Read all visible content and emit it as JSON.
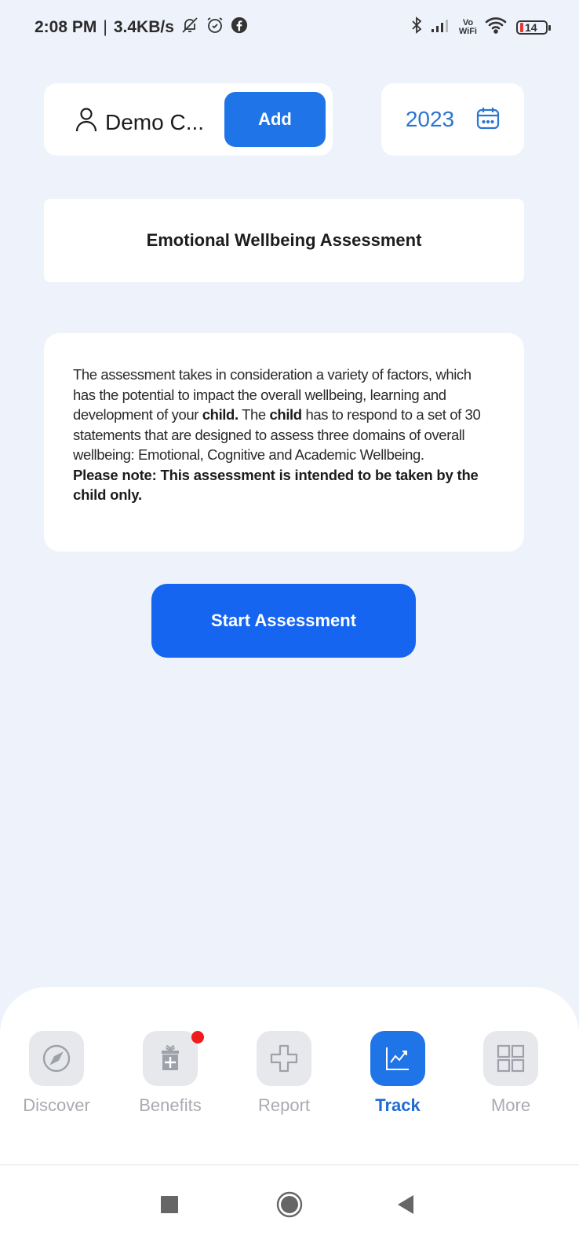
{
  "status_bar": {
    "time": "2:08 PM",
    "separator": "|",
    "network_speed": "3.4KB/s",
    "left_icons": [
      "bell-muted-icon",
      "alarm-icon",
      "facebook-icon"
    ],
    "right_icons": [
      "bluetooth-icon",
      "signal-icon",
      "vowifi-icon",
      "wifi-icon",
      "battery-icon"
    ],
    "vowifi_top": "Vo",
    "vowifi_bottom": "WiFi",
    "battery_level": "14"
  },
  "header": {
    "profile_name": "Demo C...",
    "profile_icon": "user-icon",
    "add_label": "Add",
    "year": "2023",
    "calendar_icon": "calendar-icon"
  },
  "assessment": {
    "title": "Emotional Wellbeing Assessment",
    "desc_part1": "The assessment takes in consideration a variety of factors, which has the potential to impact the overall wellbeing, learning and development of your ",
    "desc_bold1": "child.",
    "desc_part2": " The ",
    "desc_bold2": "child",
    "desc_part3": " has to respond to a set of 30 statements that are designed to assess three domains of overall wellbeing: Emotional, Cognitive and Academic Wellbeing.",
    "note": "Please note: This assessment is intended to be taken by the child only.",
    "start_label": "Start Assessment"
  },
  "bottom_nav": {
    "items": [
      {
        "label": "Discover",
        "icon": "compass-icon",
        "active": false
      },
      {
        "label": "Benefits",
        "icon": "gift-icon",
        "active": false,
        "badge": true
      },
      {
        "label": "Report",
        "icon": "medical-cross-icon",
        "active": false
      },
      {
        "label": "Track",
        "icon": "chart-trend-icon",
        "active": true
      },
      {
        "label": "More",
        "icon": "grid-icon",
        "active": false
      }
    ]
  },
  "system_nav": [
    "recents-button",
    "home-button",
    "back-button"
  ],
  "colors": {
    "accent": "#1f74e8",
    "start_button": "#1565f0",
    "background": "#eef2fb",
    "year_text": "#2a75d0",
    "badge": "#ee1c1c",
    "inactive_label": "#a9abb2"
  }
}
